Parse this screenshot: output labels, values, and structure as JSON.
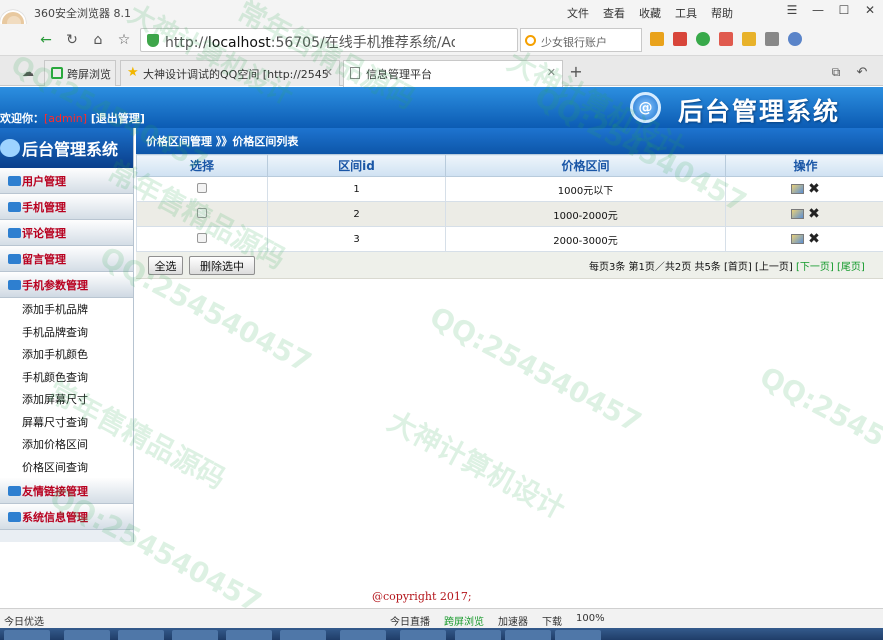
{
  "browser": {
    "name": "360安全浏览器 8.1",
    "menu": [
      "文件",
      "查看",
      "收藏",
      "工具",
      "帮助"
    ],
    "url_host": "localhost",
    "url_rest": ":56705/在线手机推荐系统/Admi",
    "search_placeholder": "少女银行账户",
    "tabs": [
      {
        "label": "跨屏浏览"
      },
      {
        "label": "大神设计调试的QQ空间 [http://2545"
      },
      {
        "label": "信息管理平台"
      }
    ],
    "status_left": "今日优选",
    "status_items": [
      "今日直播",
      "跨屏浏览",
      "加速器",
      "下载",
      "100%"
    ]
  },
  "header": {
    "welcome_label": "欢迎你：",
    "username": "[admin]",
    "logout_label": "[退出管理]",
    "logo_glyph": "@",
    "logo_text": "后台管理系统"
  },
  "sidebar": {
    "title": "后台管理系统",
    "sections_top": [
      {
        "label": "用户管理"
      },
      {
        "label": "手机管理"
      },
      {
        "label": "评论管理"
      },
      {
        "label": "留言管理"
      }
    ],
    "open_section": "手机参数管理",
    "sub_items": [
      {
        "label": "添加手机品牌"
      },
      {
        "label": "手机品牌查询"
      },
      {
        "label": "添加手机颜色"
      },
      {
        "label": "手机颜色查询"
      },
      {
        "label": "添加屏幕尺寸"
      },
      {
        "label": "屏幕尺寸查询"
      },
      {
        "label": "添加价格区间"
      },
      {
        "label": "价格区间查询"
      }
    ],
    "sections_bottom": [
      {
        "label": "友情链接管理"
      },
      {
        "label": "系统信息管理"
      }
    ]
  },
  "main": {
    "breadcrumb": "价格区间管理 》》价格区间列表",
    "columns": [
      "选择",
      "区间id",
      "价格区间",
      "操作"
    ],
    "rows": [
      {
        "id": "1",
        "range": "1000元以下"
      },
      {
        "id": "2",
        "range": "1000-2000元"
      },
      {
        "id": "3",
        "range": "2000-3000元"
      }
    ],
    "select_all_label": "全选",
    "delete_selected_label": "删除选中",
    "pager": {
      "summary": "每页3条 第1页／共2页 共5条",
      "first": "[首页]",
      "prev": "[上一页]",
      "next": "[下一页]",
      "last": "[尾页]"
    }
  },
  "footer": {
    "copyright": "@copyright 2017;"
  },
  "watermarks": [
    "大神计算机设计",
    "QQ:254540457",
    "常年售精品源码",
    "QQ:254540457",
    "大神计算机设计",
    "QQ:254540457",
    "常年售精品源码",
    "QQ:254540457",
    "大神计算机设计",
    "常年售精品源码",
    "QQ:2545",
    "QQ:254540457"
  ]
}
